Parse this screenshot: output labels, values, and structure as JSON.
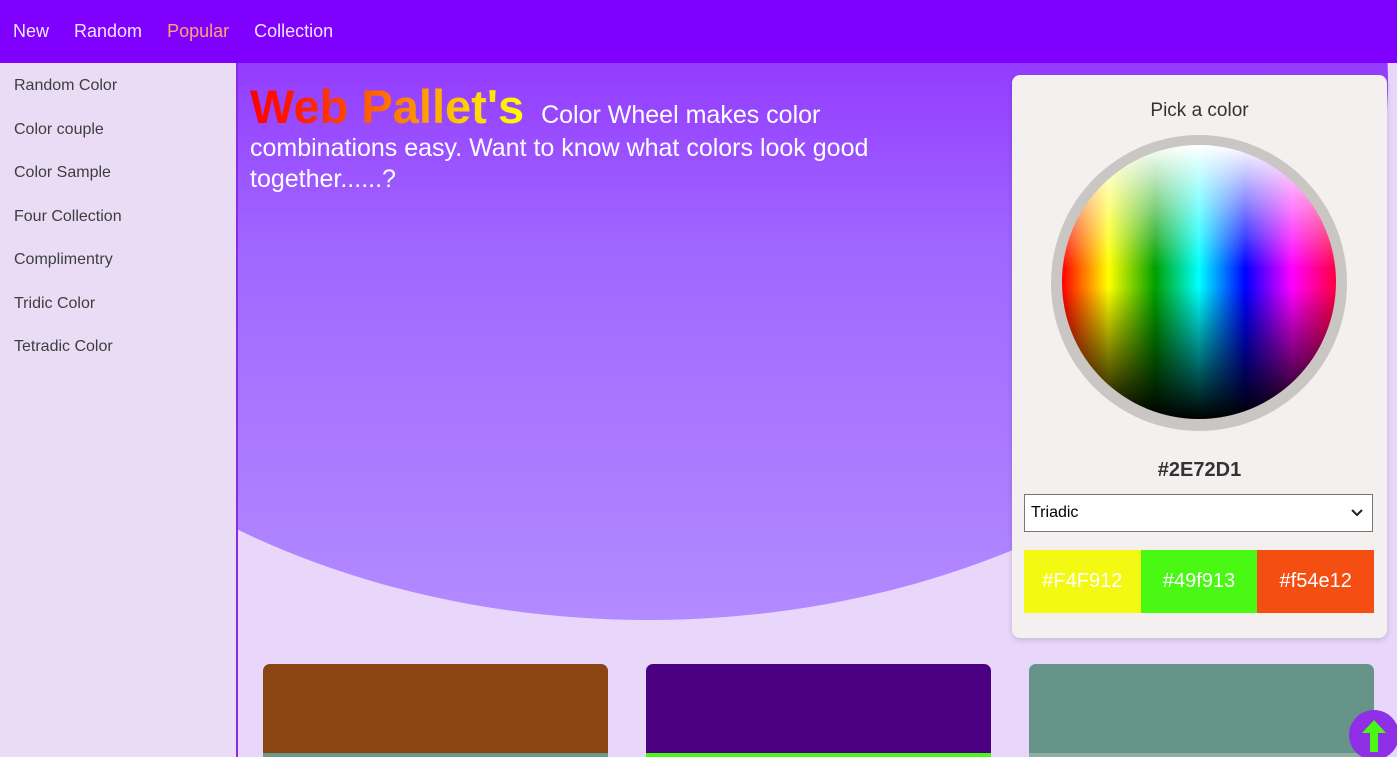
{
  "nav": {
    "items": [
      {
        "label": "New",
        "active": false
      },
      {
        "label": "Random",
        "active": false
      },
      {
        "label": "Popular",
        "active": true
      },
      {
        "label": "Collection",
        "active": false
      }
    ]
  },
  "sidebar": {
    "items": [
      {
        "label": "Random Color"
      },
      {
        "label": "Color couple"
      },
      {
        "label": "Color Sample"
      },
      {
        "label": "Four Collection"
      },
      {
        "label": "Complimentry"
      },
      {
        "label": "Tridic Color"
      },
      {
        "label": "Tetradic Color"
      }
    ]
  },
  "hero": {
    "title": "Web Pallet's",
    "description": "Color Wheel makes color combinations easy. Want to know what colors look good together......?"
  },
  "picker": {
    "title": "Pick a color",
    "hex": "#2E72D1",
    "scheme": "Triadic",
    "swatches": [
      {
        "label": "#F4F912",
        "color": "#f4f912"
      },
      {
        "label": "#49f913",
        "color": "#49f913"
      },
      {
        "label": "#f54e12",
        "color": "#f54e12"
      }
    ]
  },
  "cards": [
    {
      "color": "#8b4513",
      "strip": "#6a9a8a"
    },
    {
      "color": "#4b0082",
      "strip": "#49f913"
    },
    {
      "color": "#669488",
      "strip": "#8fb0a0"
    }
  ],
  "colors": {
    "nav_bg": "#7f00ff",
    "nav_active": "#ffa56b",
    "accent": "#8a2be2",
    "to_top_arrow": "#49f913"
  },
  "icons": {
    "scheme_dropdown": "chevron-down-icon",
    "back_to_top": "arrow-up-icon"
  }
}
